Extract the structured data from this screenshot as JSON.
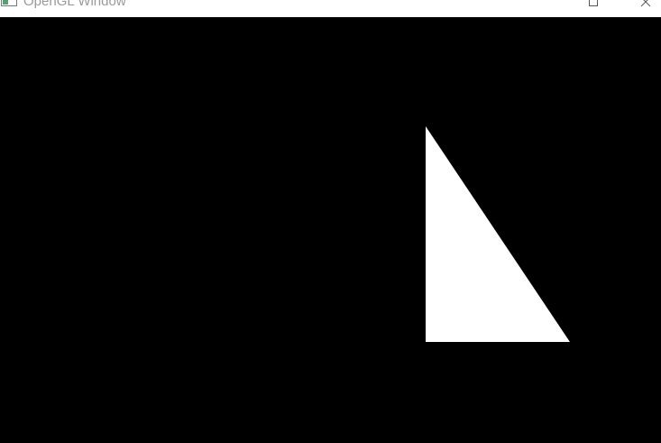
{
  "window": {
    "title": "OpenGL Window",
    "icon": "app-window-icon",
    "controls": {
      "maximize_icon": "maximize-icon",
      "close_icon": "close-icon"
    }
  },
  "viewport": {
    "background_color": "#000000",
    "shape": {
      "type": "triangle",
      "fill_color": "#ffffff"
    }
  }
}
